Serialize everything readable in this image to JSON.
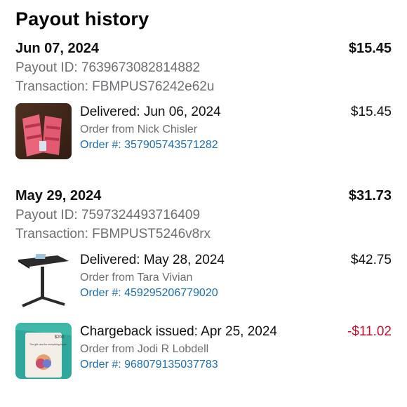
{
  "header": {
    "title": "Payout history"
  },
  "payouts": [
    {
      "date": "Jun 07, 2024",
      "total": "$15.45",
      "payout_id": "Payout ID: 7639673082814882",
      "transaction": "Transaction: FBMPUS76242e62u",
      "orders": [
        {
          "status": "Delivered: Jun 06, 2024",
          "from": "Order from Nick Chisler",
          "order_number": "Order #: 357905743571282",
          "amount": "$15.45",
          "thumb_icon": "pink-sandals-photo"
        }
      ]
    },
    {
      "date": "May 29, 2024",
      "total": "$31.73",
      "payout_id": "Payout ID: 7597324493716409",
      "transaction": "Transaction: FBMPUST5246v8rx",
      "orders": [
        {
          "status": "Delivered: May 28, 2024",
          "from": "Order from Tara Vivian",
          "order_number": "Order #: 459295206779020",
          "amount": "$42.75",
          "thumb_icon": "standing-desk-photo"
        },
        {
          "status": "Chargeback issued: Apr 25, 2024",
          "from": "Order from Jodi R Lobdell",
          "order_number": "Order #: 968079135037783",
          "amount": "-$11.02",
          "thumb_icon": "apple-gift-card-photo",
          "gift_card_text": "The gift card for everything Apple",
          "gift_card_value": "$200"
        }
      ]
    }
  ],
  "colors": {
    "link": "#1a6fb5",
    "negative": "#c8102e",
    "secondary": "#6e6e73"
  }
}
